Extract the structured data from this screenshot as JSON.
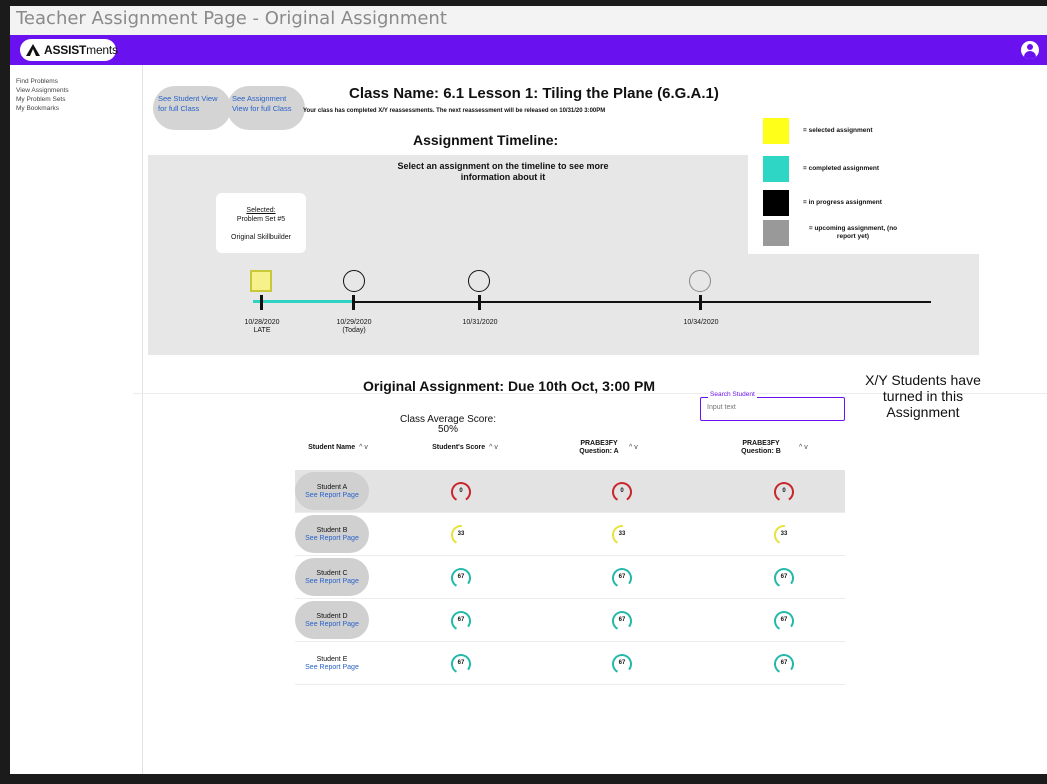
{
  "window_title": "Teacher Assignment Page - Original Assignment",
  "brand": {
    "name_bold": "ASSIST",
    "name_rest": "ments"
  },
  "sidebar": [
    "Find Problems",
    "View Assignments",
    "My Problem Sets",
    "My Bookmarks"
  ],
  "buttons": {
    "student_view": "See Student View for full Class",
    "assignment_view": "See Assignment View for full Class"
  },
  "class_name": "Class Name: 6.1 Lesson 1: Tiling the Plane (6.G.A.1)",
  "class_subtitle": "Your class has completed X/Y reassessments. The next reassessment will be released on 10/31/20 3:00PM",
  "timeline": {
    "title": "Assignment Timeline:",
    "instruction": "Select an assignment on the timeline to see more information about it",
    "selected_card": {
      "label": "Selected:",
      "set": "Problem Set #5",
      "type": "Original Skillbuilder"
    },
    "dates": [
      {
        "l1": "10/28/2020",
        "l2": "LATE"
      },
      {
        "l1": "10/29/2020",
        "l2": "(Today)"
      },
      {
        "l1": "10/31/2020",
        "l2": ""
      },
      {
        "l1": "10/34/2020",
        "l2": ""
      }
    ]
  },
  "legend": [
    {
      "color": "#ffff1a",
      "text": "= selected assignment"
    },
    {
      "color": "#2ed6c6",
      "text": "= completed assignment"
    },
    {
      "color": "#000000",
      "text": "= in progress assignment"
    },
    {
      "color": "#999999",
      "text": "= upcoming assignment, (no report yet)"
    }
  ],
  "assignment": {
    "title": "Original Assignment: Due 10th Oct, 3:00 PM",
    "submitted_note": "X/Y Students have turned in this Assignment",
    "search_label": "Search Student",
    "search_placeholder": "Input text",
    "class_avg_label": "Class Average Score:",
    "class_avg_value": "50%"
  },
  "table": {
    "headers": [
      "Student Name",
      "Student's Score",
      "PRABE3FY Question: A",
      "PRABE3FY Question: B"
    ],
    "sort_glyphs": "^ v",
    "report_link": "See Report Page",
    "rows": [
      {
        "name": "Student A",
        "scores": [
          0,
          0,
          0
        ]
      },
      {
        "name": "Student B",
        "scores": [
          33,
          33,
          33
        ]
      },
      {
        "name": "Student C",
        "scores": [
          67,
          67,
          67
        ]
      },
      {
        "name": "Student D",
        "scores": [
          67,
          67,
          67
        ]
      },
      {
        "name": "Student E",
        "scores": [
          67,
          67,
          67
        ]
      }
    ]
  }
}
